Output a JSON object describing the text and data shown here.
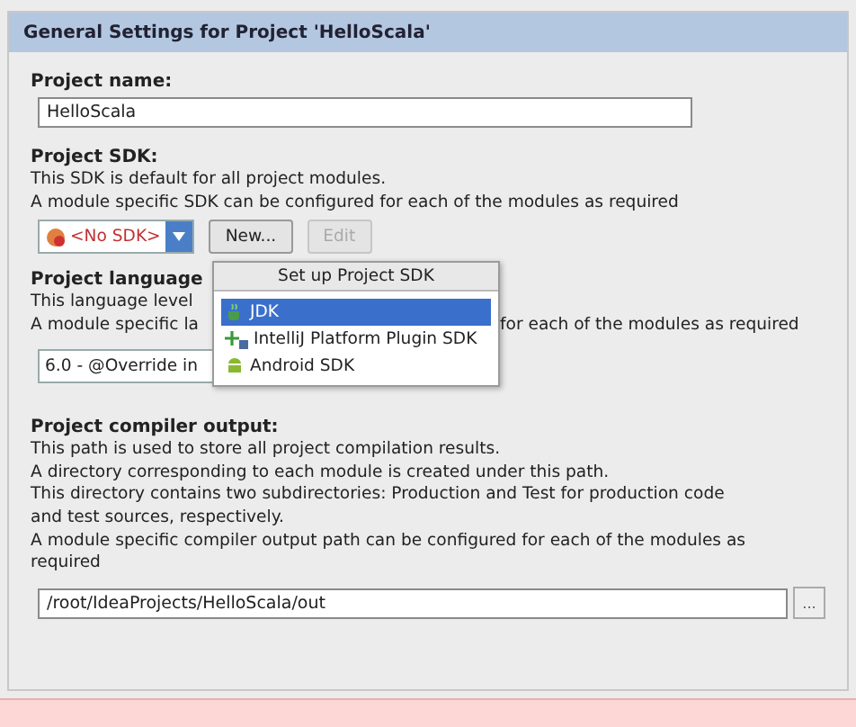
{
  "header": {
    "title": "General Settings for Project 'HelloScala'"
  },
  "project_name": {
    "label": "Project name:",
    "value": "HelloScala"
  },
  "project_sdk": {
    "label": "Project SDK:",
    "description": [
      "This SDK is default for all project modules.",
      "A module specific SDK can be configured for each of the modules as required"
    ],
    "combo_value": "<No SDK>",
    "buttons": [
      {
        "label": "New...",
        "disabled": false
      },
      {
        "label": "Edit",
        "disabled": true
      }
    ]
  },
  "sdk_popup": {
    "title": "Set up Project SDK",
    "items": [
      {
        "label": "JDK",
        "kind": "jdk",
        "selected": true
      },
      {
        "label": "IntelliJ Platform Plugin SDK",
        "kind": "plugin",
        "selected": false
      },
      {
        "label": "Android SDK",
        "kind": "android",
        "selected": false
      }
    ]
  },
  "project_language": {
    "label": "Project language",
    "description": [
      {
        "left": "This language level"
      },
      {
        "left": "A module specific la",
        "right": "for each of the modules as required"
      }
    ],
    "combo_value": "6.0 - @Override in"
  },
  "compiler_output": {
    "label": "Project compiler output:",
    "description": [
      "This path is used to store all project compilation results.",
      "A directory corresponding to each module is created under this path.",
      "This directory contains two subdirectories: Production and Test for production code",
      "and test sources, respectively.",
      "A module specific compiler output path can be configured for each of the modules as",
      "required"
    ],
    "path": "/root/IdeaProjects/HelloScala/out",
    "browse_label": "..."
  }
}
